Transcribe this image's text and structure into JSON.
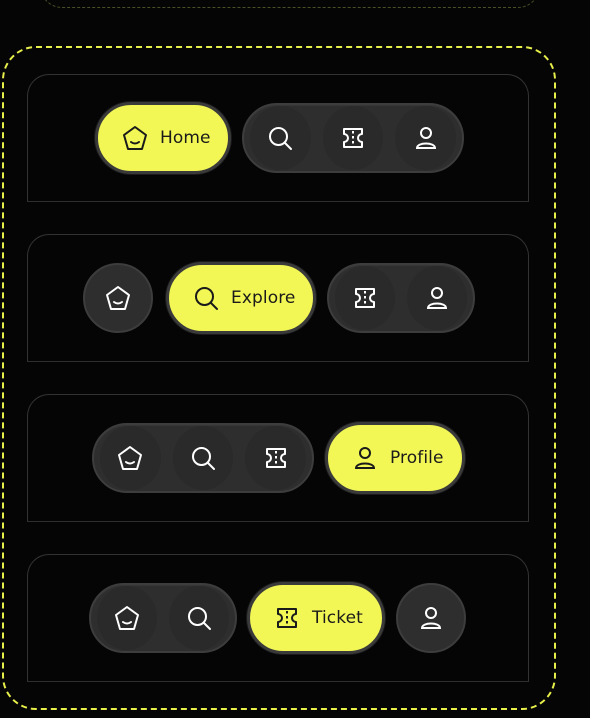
{
  "colors": {
    "accent": "#f2f755",
    "surface": "#2e2e2e",
    "background": "#050505",
    "frame": "#e7ef4a"
  },
  "variants": [
    {
      "active_label": "Home"
    },
    {
      "active_label": "Explore"
    },
    {
      "active_label": "Profile"
    },
    {
      "active_label": "Ticket"
    }
  ],
  "icons": [
    "home-icon",
    "search-icon",
    "ticket-icon",
    "profile-icon"
  ]
}
